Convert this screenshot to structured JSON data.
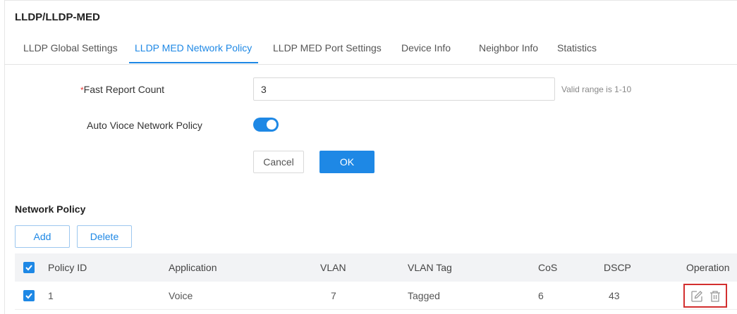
{
  "header": {
    "title": "LLDP/LLDP-MED"
  },
  "tabs": [
    {
      "label": "LLDP Global Settings"
    },
    {
      "label": "LLDP MED Network Policy",
      "active": true
    },
    {
      "label": "LLDP MED Port Settings"
    },
    {
      "label": "Device Info"
    },
    {
      "label": "Neighbor Info"
    },
    {
      "label": "Statistics"
    }
  ],
  "form": {
    "fast_report": {
      "required_mark": "*",
      "label": "Fast Report Count",
      "value": "3",
      "hint": "Valid range is 1-10"
    },
    "auto_voice": {
      "label": "Auto Vioce Network Policy",
      "enabled": true
    },
    "cancel_label": "Cancel",
    "ok_label": "OK"
  },
  "network_policy": {
    "title": "Network Policy",
    "add_label": "Add",
    "delete_label": "Delete",
    "columns": [
      "Policy ID",
      "Application",
      "VLAN",
      "VLAN Tag",
      "CoS",
      "DSCP",
      "Operation"
    ],
    "rows": [
      {
        "checked": true,
        "policy_id": "1",
        "application": "Voice",
        "vlan": "7",
        "vlan_tag": "Tagged",
        "cos": "6",
        "dscp": "43"
      }
    ]
  },
  "icons": {
    "edit": "edit-icon",
    "delete": "trash-icon",
    "checkbox": "check-icon"
  },
  "colors": {
    "accent": "#1e88e5",
    "highlight": "#d32f2f",
    "header_bg": "#f2f3f5"
  }
}
